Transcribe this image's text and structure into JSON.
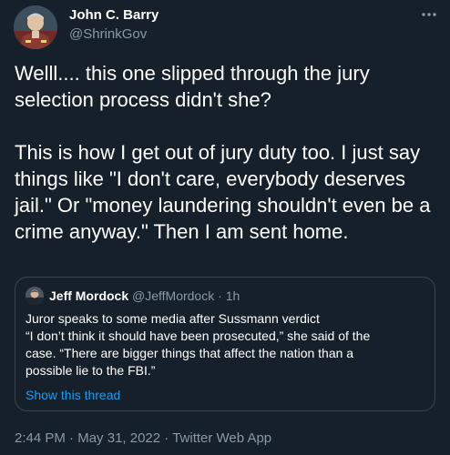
{
  "tweet": {
    "author": {
      "display_name": "John C. Barry",
      "handle": "@ShrinkGov",
      "avatar_icon": "profile-photo"
    },
    "more_icon": "ellipsis-icon",
    "text": {
      "paragraph1": "Welll.... this one slipped through the jury selection process didn't she?",
      "paragraph2": "This is how I get out of jury duty too. I just say things like \"I don't care, everybody deserves jail.\" Or \"money laundering shouldn't even be a crime anyway.\" Then I am sent home."
    },
    "quote": {
      "author": {
        "display_name": "Jeff Mordock",
        "handle": "@JeffMordock",
        "separator": "·",
        "time": "1h"
      },
      "lines": [
        "Juror speaks to some media after Sussmann verdict",
        "“I don’t think it should have been prosecuted,” she said of the",
        "case. “There are bigger things that affect the nation than a",
        "possible lie to the FBI.”"
      ],
      "show_thread": "Show this thread"
    },
    "meta": {
      "time": "2:44 PM",
      "separator1": " · ",
      "date": "May 31, 2022",
      "separator2": " · ",
      "app": "Twitter Web App"
    }
  },
  "colors": {
    "background": "#15202b",
    "text": "#ffffff",
    "secondary": "#8b98a5",
    "link": "#1d9bf0",
    "border": "#38444d"
  }
}
